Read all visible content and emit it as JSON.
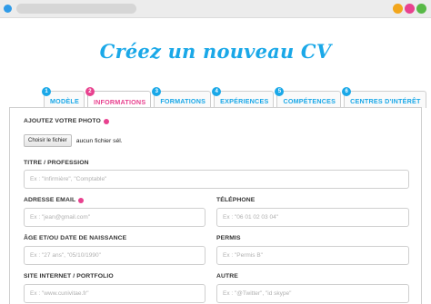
{
  "colors": {
    "tab_text": "#1aa8e8",
    "tab_text_active": "#e8428f",
    "required_dot": "#e8428f",
    "title": "#1aa8e8",
    "window_dots": [
      "#f2a61c",
      "#e8428f",
      "#58b947"
    ],
    "left_dot": "#2f9be8"
  },
  "page": {
    "title": "Créez un nouveau CV"
  },
  "tabs": [
    {
      "number": "1",
      "label": "MODÈLE",
      "color": "#1aa8e8",
      "active": false
    },
    {
      "number": "2",
      "label": "INFORMATIONS",
      "color": "#e8428f",
      "active": true
    },
    {
      "number": "3",
      "label": "FORMATIONS",
      "color": "#1aa8e8",
      "active": false
    },
    {
      "number": "4",
      "label": "EXPÉRIENCES",
      "color": "#1aa8e8",
      "active": false
    },
    {
      "number": "5",
      "label": "COMPÉTENCES",
      "color": "#1aa8e8",
      "active": false
    },
    {
      "number": "6",
      "label": "CENTRES D'INTÉRÊT",
      "color": "#1aa8e8",
      "active": false
    }
  ],
  "form": {
    "photo": {
      "label": "AJOUTEZ VOTRE PHOTO",
      "button": "Choisir le fichier",
      "status": "aucun fichier sél."
    },
    "titre": {
      "label": "TITRE / PROFESSION",
      "placeholder": "Ex : \"Infirmière\", \"Comptable\""
    },
    "email": {
      "label": "ADRESSE EMAIL",
      "placeholder": "Ex : \"jean@gmail.com\""
    },
    "telephone": {
      "label": "TÉLÉPHONE",
      "placeholder": "Ex : \"06 01 02 03 04\""
    },
    "age": {
      "label": "ÂGE ET/OU DATE DE NAISSANCE",
      "placeholder": "Ex : \"27 ans\", \"05/10/1990\""
    },
    "permis": {
      "label": "PERMIS",
      "placeholder": "Ex : \"Permis B\""
    },
    "site": {
      "label": "SITE INTERNET / PORTFOLIO",
      "placeholder": "Ex : \"www.cunivitae.fr\""
    },
    "autre": {
      "label": "AUTRE",
      "placeholder": "Ex : \"@Twitter\", \"id skype\""
    }
  }
}
